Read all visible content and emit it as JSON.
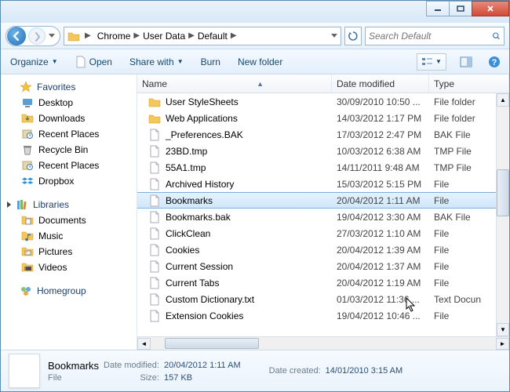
{
  "breadcrumbs": [
    "Chrome",
    "User Data",
    "Default"
  ],
  "search_placeholder": "Search Default",
  "toolbar": {
    "organize": "Organize",
    "open": "Open",
    "share": "Share with",
    "burn": "Burn",
    "newfolder": "New folder"
  },
  "sidebar": {
    "favorites": "Favorites",
    "fav_items": [
      {
        "label": "Desktop",
        "icon": "desktop"
      },
      {
        "label": "Downloads",
        "icon": "downloads"
      },
      {
        "label": "Recent Places",
        "icon": "recent"
      },
      {
        "label": "Recycle Bin",
        "icon": "recycle"
      },
      {
        "label": "Recent Places",
        "icon": "recent"
      },
      {
        "label": "Dropbox",
        "icon": "dropbox"
      }
    ],
    "libraries": "Libraries",
    "lib_items": [
      {
        "label": "Documents",
        "icon": "documents"
      },
      {
        "label": "Music",
        "icon": "music"
      },
      {
        "label": "Pictures",
        "icon": "pictures"
      },
      {
        "label": "Videos",
        "icon": "videos"
      }
    ],
    "homegroup": "Homegroup"
  },
  "columns": {
    "name": "Name",
    "date": "Date modified",
    "type": "Type"
  },
  "files": [
    {
      "name": "User StyleSheets",
      "date": "30/09/2010 10:50 ...",
      "type": "File folder",
      "icon": "folder"
    },
    {
      "name": "Web Applications",
      "date": "14/03/2012 1:17 PM",
      "type": "File folder",
      "icon": "folder"
    },
    {
      "name": "_Preferences.BAK",
      "date": "17/03/2012 2:47 PM",
      "type": "BAK File",
      "icon": "file"
    },
    {
      "name": "23BD.tmp",
      "date": "10/03/2012 6:38 AM",
      "type": "TMP File",
      "icon": "file"
    },
    {
      "name": "55A1.tmp",
      "date": "14/11/2011 9:48 AM",
      "type": "TMP File",
      "icon": "file"
    },
    {
      "name": "Archived History",
      "date": "15/03/2012 5:15 PM",
      "type": "File",
      "icon": "file"
    },
    {
      "name": "Bookmarks",
      "date": "20/04/2012 1:11 AM",
      "type": "File",
      "icon": "file",
      "selected": true
    },
    {
      "name": "Bookmarks.bak",
      "date": "19/04/2012 3:30 AM",
      "type": "BAK File",
      "icon": "file"
    },
    {
      "name": "ClickClean",
      "date": "27/03/2012 1:10 AM",
      "type": "File",
      "icon": "file"
    },
    {
      "name": "Cookies",
      "date": "20/04/2012 1:39 AM",
      "type": "File",
      "icon": "file"
    },
    {
      "name": "Current Session",
      "date": "20/04/2012 1:37 AM",
      "type": "File",
      "icon": "file"
    },
    {
      "name": "Current Tabs",
      "date": "20/04/2012 1:19 AM",
      "type": "File",
      "icon": "file"
    },
    {
      "name": "Custom Dictionary.txt",
      "date": "01/03/2012 11:36 ...",
      "type": "Text Docun",
      "icon": "file"
    },
    {
      "name": "Extension Cookies",
      "date": "19/04/2012 10:46 ...",
      "type": "File",
      "icon": "file"
    }
  ],
  "details": {
    "filename": "Bookmarks",
    "filetype": "File",
    "datemod_label": "Date modified:",
    "datemod": "20/04/2012 1:11 AM",
    "size_label": "Size:",
    "size": "157 KB",
    "datecreated_label": "Date created:",
    "datecreated": "14/01/2010 3:15 AM"
  }
}
